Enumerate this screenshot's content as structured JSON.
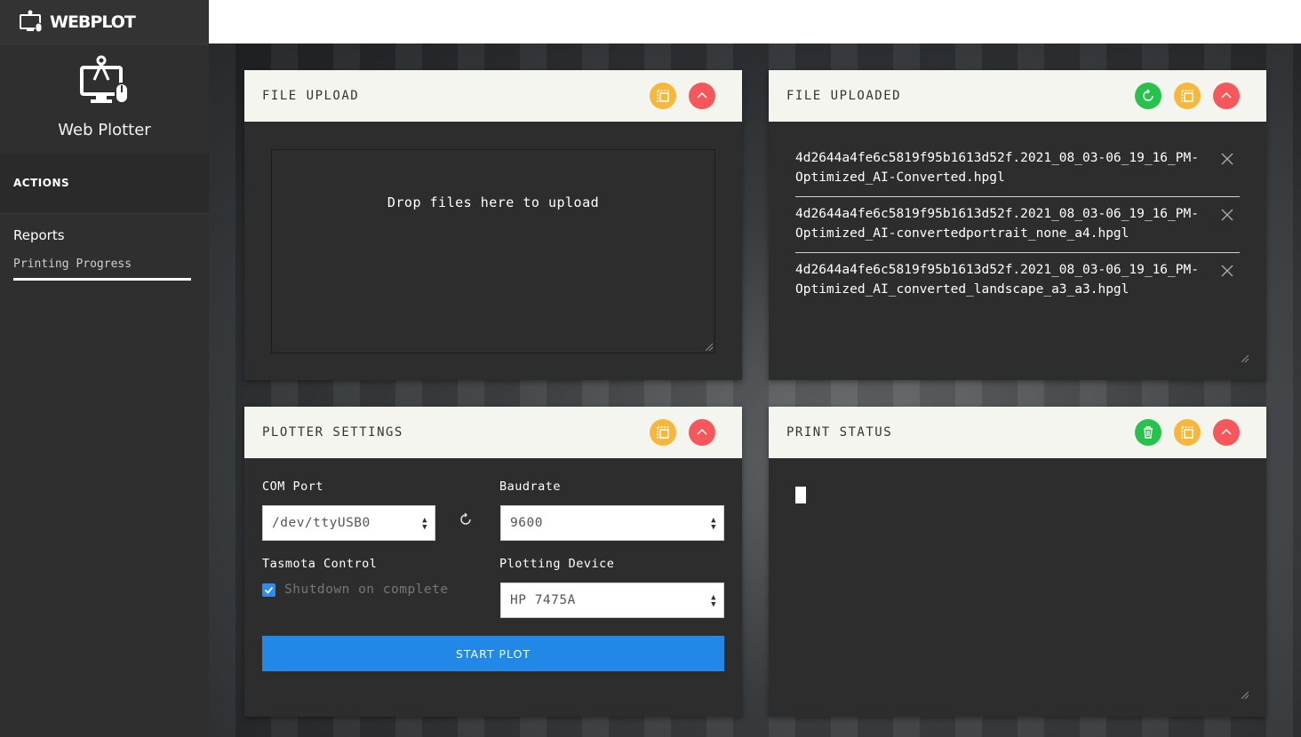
{
  "app": {
    "brand": "WEBPLOT",
    "profile_name": "Web Plotter"
  },
  "sidebar": {
    "section": "ACTIONS",
    "items": [
      {
        "label": "Reports"
      },
      {
        "label": "Printing Progress",
        "active": true
      }
    ]
  },
  "panels": {
    "upload": {
      "title": "FILE UPLOAD",
      "dropzone_text": "Drop files here to upload"
    },
    "uploaded": {
      "title": "FILE UPLOADED",
      "files": [
        "4d2644a4fe6c5819f95b1613d52f.2021_08_03-06_19_16_PM-Optimized_AI-Converted.hpgl",
        "4d2644a4fe6c5819f95b1613d52f.2021_08_03-06_19_16_PM-Optimized_AI-convertedportrait_none_a4.hpgl",
        "4d2644a4fe6c5819f95b1613d52f.2021_08_03-06_19_16_PM-Optimized_AI_converted_landscape_a3_a3.hpgl"
      ]
    },
    "settings": {
      "title": "PLOTTER SETTINGS",
      "com_port_label": "COM Port",
      "com_port_value": "/dev/ttyUSB0",
      "baudrate_label": "Baudrate",
      "baudrate_value": "9600",
      "tasmota_label": "Tasmota Control",
      "shutdown_label": "Shutdown on complete",
      "shutdown_checked": true,
      "device_label": "Plotting Device",
      "device_value": "HP 7475A",
      "start_label": "START PLOT"
    },
    "status": {
      "title": "PRINT STATUS"
    }
  },
  "colors": {
    "accent": "#2188e8",
    "orange": "#f8b739",
    "red": "#f6575a",
    "green": "#27c24c"
  }
}
